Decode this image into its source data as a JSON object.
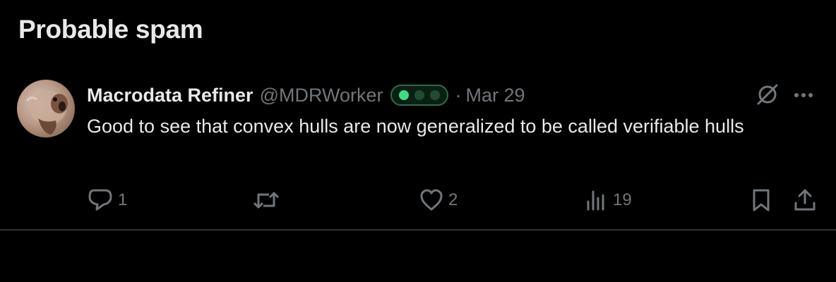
{
  "section": {
    "title": "Probable spam"
  },
  "tweet": {
    "display_name": "Macrodata Refiner",
    "handle": "@MDRWorker",
    "separator": "·",
    "date": "Mar 29",
    "text": "Good to see that convex hulls are now generalized to be called verifiable hulls",
    "avatar": "avatar-squirrel-image",
    "badge": "status-dots-badge"
  },
  "actions": {
    "reply_count": "1",
    "retweet_count": "",
    "like_count": "2",
    "views_count": "19"
  },
  "icons": {
    "grok": "grok-icon",
    "more": "more-icon",
    "reply": "reply-icon",
    "retweet": "retweet-icon",
    "like": "heart-icon",
    "views": "views-icon",
    "bookmark": "bookmark-icon",
    "share": "share-icon"
  },
  "colors": {
    "background": "#000000",
    "text_primary": "#e7e9ea",
    "text_secondary": "#71767b",
    "badge_green": "#3ddc84",
    "divider": "#2f3336"
  }
}
